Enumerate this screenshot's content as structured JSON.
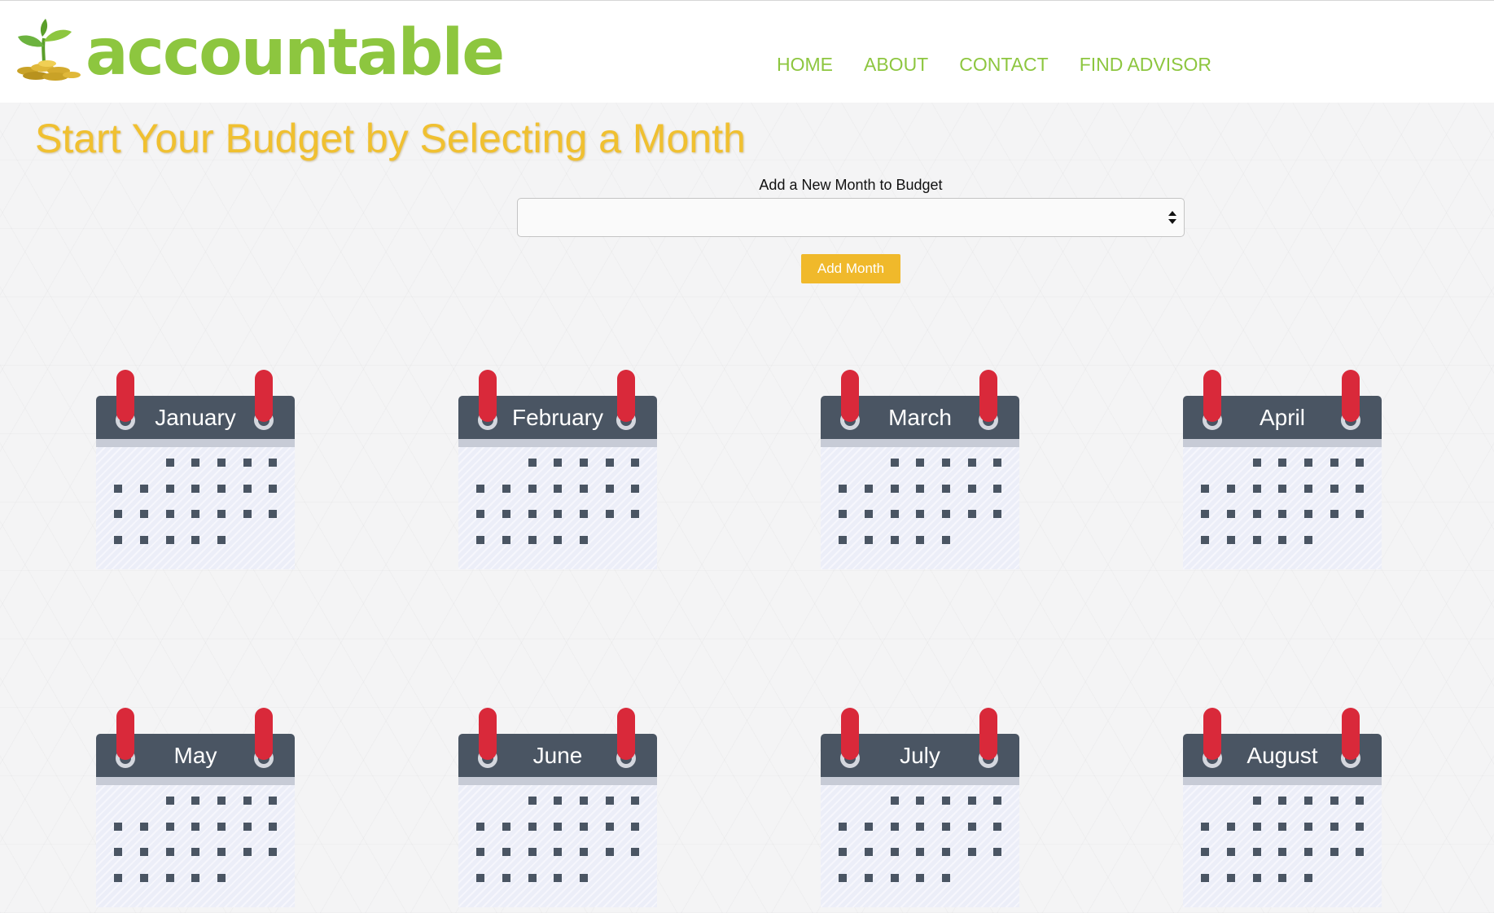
{
  "brand": {
    "name": "accountable"
  },
  "nav": {
    "items": [
      {
        "label": "HOME"
      },
      {
        "label": "ABOUT"
      },
      {
        "label": "CONTACT"
      },
      {
        "label": "FIND ADVISOR"
      }
    ]
  },
  "main": {
    "title": "Start Your Budget by Selecting a Month",
    "form": {
      "label": "Add a New Month to Budget",
      "select_value": "",
      "button_label": "Add Month"
    }
  },
  "months": [
    {
      "name": "January"
    },
    {
      "name": "February"
    },
    {
      "name": "March"
    },
    {
      "name": "April"
    },
    {
      "name": "May"
    },
    {
      "name": "June"
    },
    {
      "name": "July"
    },
    {
      "name": "August"
    }
  ],
  "colors": {
    "brand_green": "#8dc63f",
    "title_gold": "#f0c030",
    "button_gold": "#f0b92b",
    "calendar_header": "#4a5563",
    "calendar_peg": "#d9293a",
    "calendar_body": "#eceef8"
  },
  "icons": {
    "logo": "sprout-coins-icon",
    "select_arrows": "up-down-arrows-icon",
    "calendar": "calendar-icon"
  }
}
